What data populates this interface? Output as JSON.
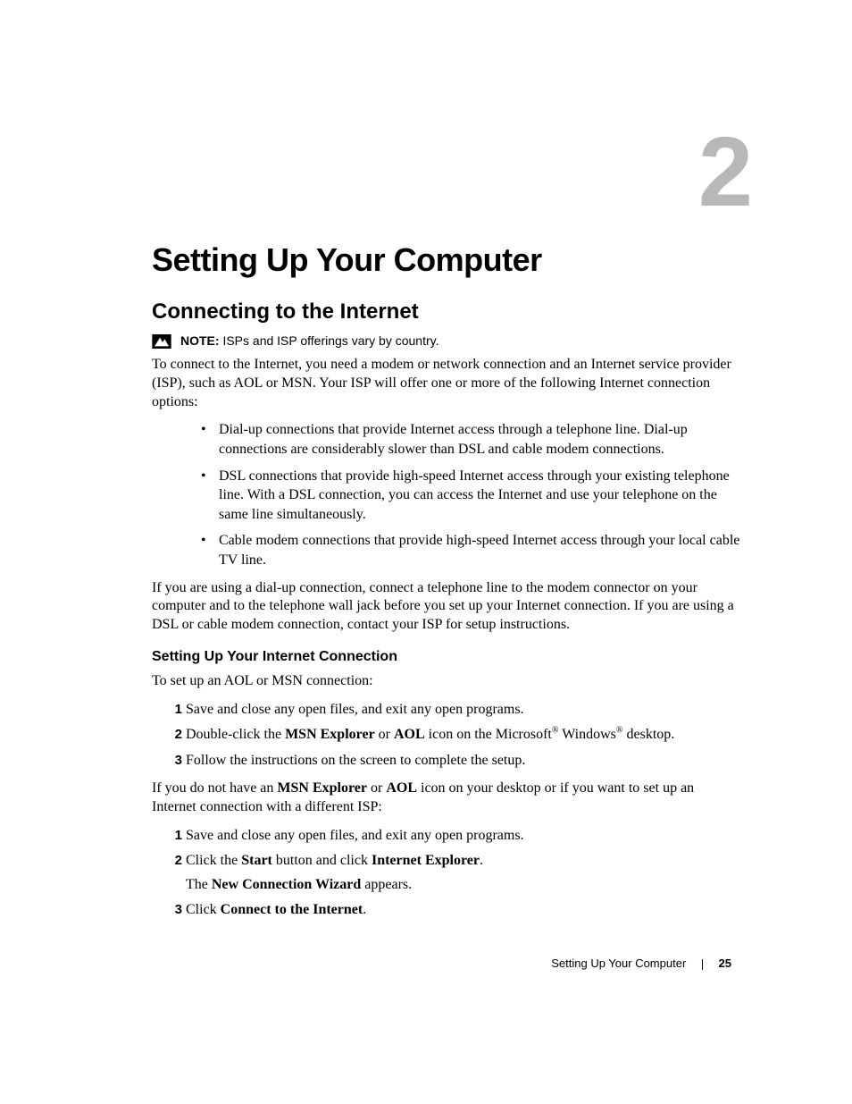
{
  "chapter": {
    "number": "2",
    "title": "Setting Up Your Computer"
  },
  "section": {
    "title": "Connecting to the Internet",
    "note": {
      "label": "NOTE:",
      "text": "ISPs and ISP offerings vary by country."
    },
    "intro": "To connect to the Internet, you need a modem or network connection and an Internet service provider (ISP), such as AOL or MSN. Your ISP will offer one or more of the following Internet connection options:",
    "bullets": [
      "Dial-up connections that provide Internet access through a telephone line. Dial-up connections are considerably slower than DSL and cable modem connections.",
      "DSL connections that provide high-speed Internet access through your existing telephone line. With a DSL connection, you can access the Internet and use your telephone on the same line simultaneously.",
      "Cable modem connections that provide high-speed Internet access through your local cable TV line."
    ],
    "after_bullets": "If you are using a dial-up connection, connect a telephone line to the modem connector on your computer and to the telephone wall jack before you set up your Internet connection. If you are using a DSL or cable modem connection, contact your ISP for setup instructions."
  },
  "subsection": {
    "title": "Setting Up Your Internet Connection",
    "lead1": "To set up an AOL or MSN connection:",
    "steps1": {
      "s1": "Save and close any open files, and exit any open programs.",
      "s2": {
        "pre": "Double-click the ",
        "b1": "MSN Explorer",
        "mid1": " or ",
        "b2": "AOL",
        "mid2": " icon on the Microsoft",
        "reg1": "®",
        "mid3": " Windows",
        "reg2": "®",
        "post": " desktop."
      },
      "s3": "Follow the instructions on the screen to complete the setup."
    },
    "lead2": {
      "pre": "If you do not have an ",
      "b1": "MSN Explorer",
      "mid1": " or ",
      "b2": "AOL",
      "post": " icon on your desktop or if you want to set up an Internet connection with a different ISP:"
    },
    "steps2": {
      "s1": "Save and close any open files, and exit any open programs.",
      "s2": {
        "pre": "Click the ",
        "b1": "Start",
        "mid": " button and click ",
        "b2": "Internet Explorer",
        "post": "."
      },
      "s2_sub": {
        "pre": "The ",
        "b1": "New Connection Wizard",
        "post": " appears."
      },
      "s3": {
        "pre": "Click ",
        "b1": "Connect to the Internet",
        "post": "."
      }
    }
  },
  "footer": {
    "title": "Setting Up Your Computer",
    "page": "25"
  }
}
